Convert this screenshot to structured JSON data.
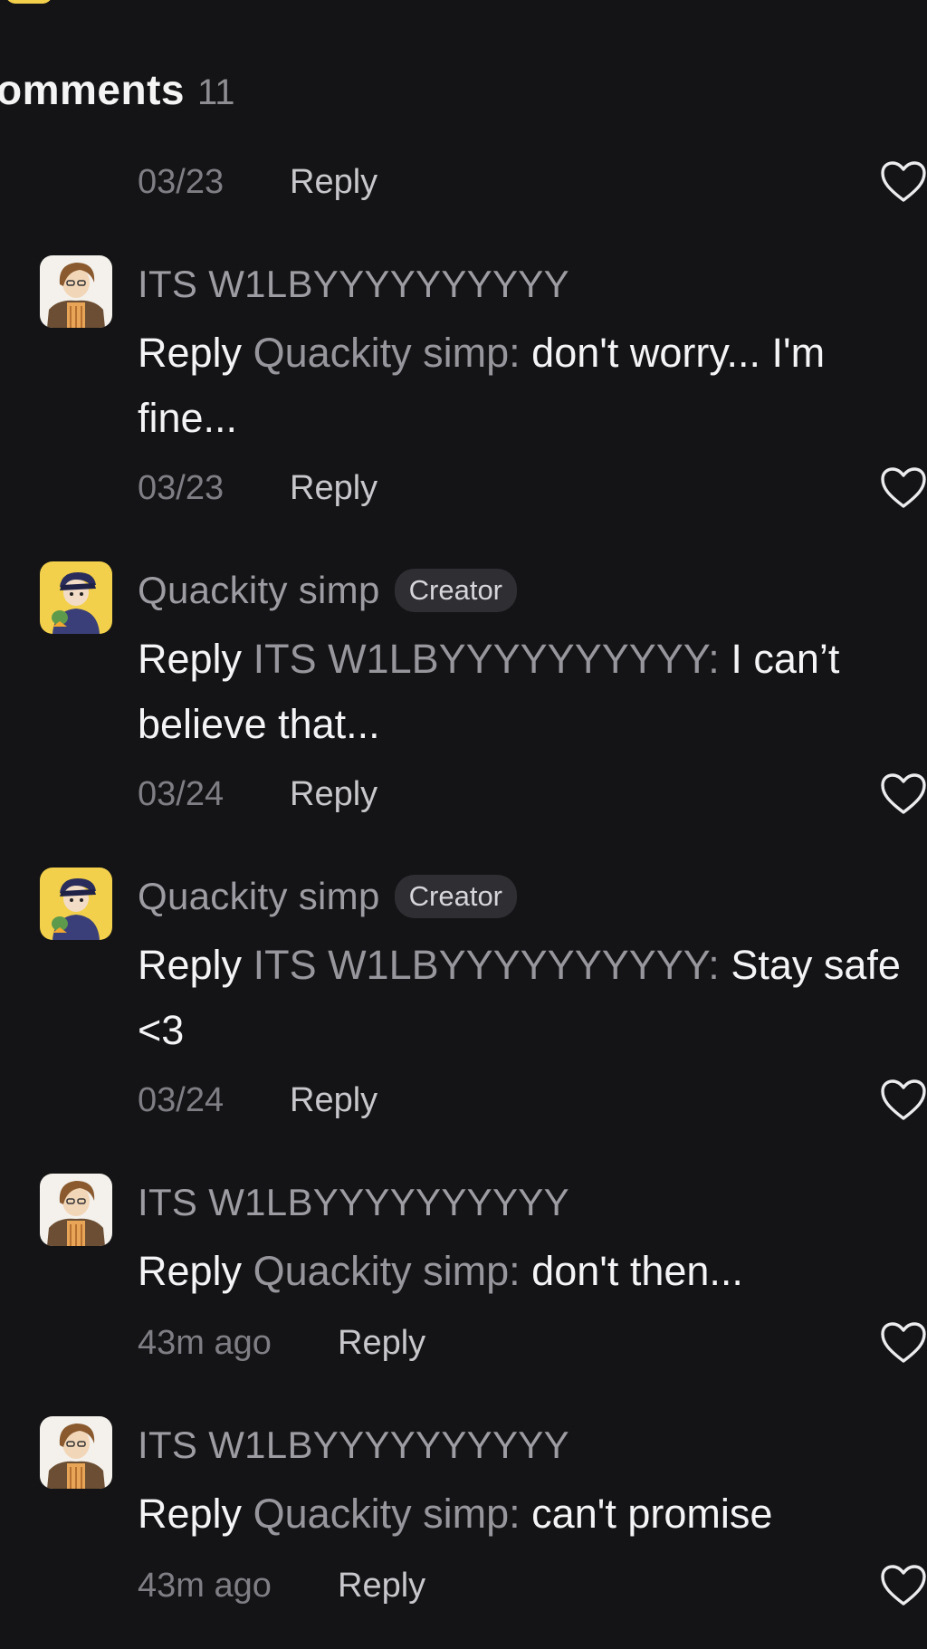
{
  "header": {
    "title": "omments",
    "count": "11"
  },
  "first_meta": {
    "date": "03/23",
    "reply_label": "Reply"
  },
  "comments": [
    {
      "author": "ITS W1LBYYYYYYYYYY",
      "badge": "",
      "reply_word": "Reply",
      "mention": "Quackity simp:",
      "text": "don't worry... I'm fine...",
      "date": "03/23",
      "reply_label": "Reply",
      "avatar_icon": "wilbur-avatar-icon"
    },
    {
      "author": "Quackity simp",
      "badge": "Creator",
      "reply_word": "Reply",
      "mention": "ITS W1LBYYYYYYYYYY:",
      "text": "I can’t believe that...",
      "date": "03/24",
      "reply_label": "Reply",
      "avatar_icon": "quackity-avatar-icon"
    },
    {
      "author": "Quackity simp",
      "badge": "Creator",
      "reply_word": "Reply",
      "mention": "ITS W1LBYYYYYYYYYY:",
      "text": "Stay safe <3",
      "date": "03/24",
      "reply_label": "Reply",
      "avatar_icon": "quackity-avatar-icon"
    },
    {
      "author": "ITS W1LBYYYYYYYYYY",
      "badge": "",
      "reply_word": "Reply",
      "mention": "Quackity simp:",
      "text": "don't then...",
      "date": "43m ago",
      "reply_label": "Reply",
      "avatar_icon": "wilbur-avatar-icon"
    },
    {
      "author": "ITS W1LBYYYYYYYYYY",
      "badge": "",
      "reply_word": "Reply",
      "mention": "Quackity simp:",
      "text": "can't promise",
      "date": "43m ago",
      "reply_label": "Reply",
      "avatar_icon": "wilbur-avatar-icon"
    }
  ],
  "icons": {
    "like": "heart-outline-icon"
  },
  "colors": {
    "background": "#141416",
    "text_primary": "#f4f4f6",
    "text_secondary": "#9c9ca2",
    "badge_bg": "#2f2f33",
    "quackity_avatar_bg": "#f2d04b"
  }
}
